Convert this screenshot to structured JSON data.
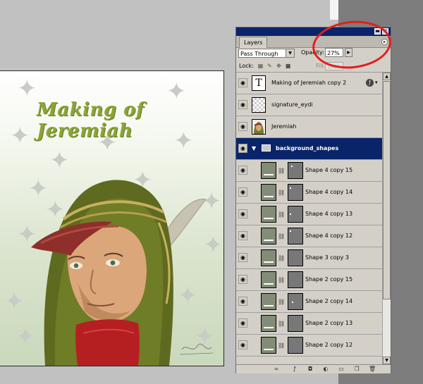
{
  "canvas": {
    "title": "Making of Jeremiah"
  },
  "panel": {
    "tab_label": "Layers",
    "window_buttons": {
      "minimize": "▬",
      "close": "✕"
    },
    "blend_mode": "Pass Through",
    "opacity_label": "Opacity:",
    "opacity_value": "27%",
    "lock_label": "Lock:",
    "fill_label": "Fill:",
    "fill_value": "100%",
    "layers": [
      {
        "name": "Making of Jeremiah copy 2",
        "type": "text"
      },
      {
        "name": "signature_eydi",
        "type": "transparent"
      },
      {
        "name": "Jeremiah",
        "type": "image"
      }
    ],
    "group": {
      "name": "background_shapes",
      "selected": true
    },
    "shape_layers": [
      {
        "name": "Shape 4 copy 15"
      },
      {
        "name": "Shape 4 copy 14"
      },
      {
        "name": "Shape 4 copy 13"
      },
      {
        "name": "Shape 4 copy 12"
      },
      {
        "name": "Shape 3 copy 3"
      },
      {
        "name": "Shape 2 copy 15"
      },
      {
        "name": "Shape 2 copy 14"
      },
      {
        "name": "Shape 2 copy 13"
      },
      {
        "name": "Shape 2 copy 12"
      }
    ]
  },
  "colors": {
    "selection": "#0a246a",
    "panel_bg": "#d4d0c8",
    "title_green": "#8aa437",
    "annotation_red": "#e31d1d"
  }
}
